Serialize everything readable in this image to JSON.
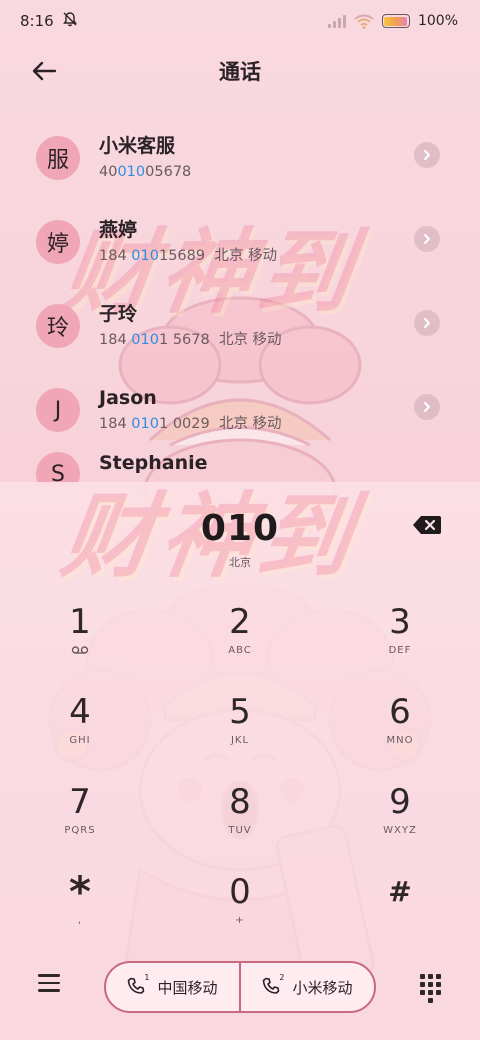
{
  "status_bar": {
    "time": "8:16",
    "battery": "100%",
    "icons": [
      "bell-off-icon",
      "signal-icon",
      "wifi-icon",
      "battery-icon"
    ]
  },
  "header": {
    "title": "通话",
    "back_icon": "arrow-left-icon"
  },
  "background": {
    "watermark_text": "财神到"
  },
  "contacts": [
    {
      "avatar": "服",
      "name": "小米客服",
      "number_pre": "40",
      "number_hl": "010",
      "number_post": "05678",
      "location": ""
    },
    {
      "avatar": "婷",
      "name": "燕婷",
      "number_pre": "184 ",
      "number_hl": "010",
      "number_post": "15689",
      "location": "北京 移动"
    },
    {
      "avatar": "玲",
      "name": "子玲",
      "number_pre": "184 ",
      "number_hl": "010",
      "number_post": "1 5678",
      "location": "北京 移动"
    },
    {
      "avatar": "J",
      "name": "Jason",
      "number_pre": "184 ",
      "number_hl": "010",
      "number_post": "1 0029",
      "location": "北京 移动"
    },
    {
      "avatar": "S",
      "name": "Stephanie",
      "number_pre": "",
      "number_hl": "",
      "number_post": "",
      "location": ""
    }
  ],
  "dialer": {
    "input": "010",
    "location": "北京",
    "keys": [
      {
        "digit": "1",
        "letters": "",
        "sub_icon": "voicemail-icon"
      },
      {
        "digit": "2",
        "letters": "ABC"
      },
      {
        "digit": "3",
        "letters": "DEF"
      },
      {
        "digit": "4",
        "letters": "GHI"
      },
      {
        "digit": "5",
        "letters": "JKL"
      },
      {
        "digit": "6",
        "letters": "MNO"
      },
      {
        "digit": "7",
        "letters": "PQRS"
      },
      {
        "digit": "8",
        "letters": "TUV"
      },
      {
        "digit": "9",
        "letters": "WXYZ"
      },
      {
        "digit": "*",
        "letters": ","
      },
      {
        "digit": "0",
        "letters": "+"
      },
      {
        "digit": "#",
        "letters": ""
      }
    ]
  },
  "bottom_bar": {
    "sim1_label": "中国移动",
    "sim1_index": "1",
    "sim2_label": "小米移动",
    "sim2_index": "2"
  },
  "colors": {
    "background": "#f8d6de",
    "avatar": "#f0a6b6",
    "highlight": "#2f8ee0",
    "button_border": "#c76a80"
  }
}
